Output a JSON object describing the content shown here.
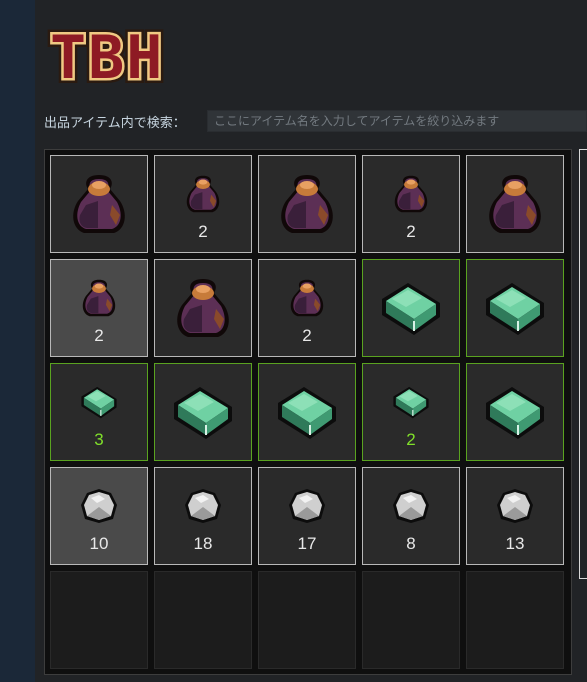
{
  "logo": {
    "text": "TBH"
  },
  "search": {
    "label": "出品アイテム内で検索：",
    "placeholder": "ここにアイテム名を入力してアイテムを絞り込みます"
  },
  "colors": {
    "sack_dark": "#3a1f3a",
    "sack_mid": "#5c2f55",
    "sack_top": "#c77b3a",
    "bar_light": "#6fd1a3",
    "bar_dark": "#2f7a5a",
    "stone": "#cfcfcf",
    "green_border": "#5aa320",
    "green_count": "#80e02a"
  },
  "grid": {
    "rows": [
      [
        {
          "item": "sack-icon-large",
          "count": ""
        },
        {
          "item": "sack-icon-small",
          "count": "2"
        },
        {
          "item": "sack-icon-large",
          "count": ""
        },
        {
          "item": "sack-icon-small",
          "count": "2"
        },
        {
          "item": "sack-icon-large",
          "count": ""
        }
      ],
      [
        {
          "item": "sack-icon-small",
          "count": "2",
          "selected": true
        },
        {
          "item": "sack-icon-large",
          "count": ""
        },
        {
          "item": "sack-icon-small",
          "count": "2"
        },
        {
          "item": "green-ingot-icon-large",
          "count": "",
          "green": true
        },
        {
          "item": "green-ingot-icon-large",
          "count": "",
          "green": true
        }
      ],
      [
        {
          "item": "green-ingot-icon-small",
          "count": "3",
          "green": true
        },
        {
          "item": "green-ingot-icon-large",
          "count": "",
          "green": true
        },
        {
          "item": "green-ingot-icon-large",
          "count": "",
          "green": true
        },
        {
          "item": "green-ingot-icon-small",
          "count": "2",
          "green": true
        },
        {
          "item": "green-ingot-icon-large",
          "count": "",
          "green": true
        }
      ],
      [
        {
          "item": "stone-icon",
          "count": "10",
          "selected": true
        },
        {
          "item": "stone-icon",
          "count": "18"
        },
        {
          "item": "stone-icon",
          "count": "17"
        },
        {
          "item": "stone-icon",
          "count": "8"
        },
        {
          "item": "stone-icon",
          "count": "13"
        }
      ],
      [
        {
          "item": "",
          "count": "",
          "empty": true
        },
        {
          "item": "",
          "count": "",
          "empty": true
        },
        {
          "item": "",
          "count": "",
          "empty": true
        },
        {
          "item": "",
          "count": "",
          "empty": true
        },
        {
          "item": "",
          "count": "",
          "empty": true
        }
      ]
    ]
  }
}
